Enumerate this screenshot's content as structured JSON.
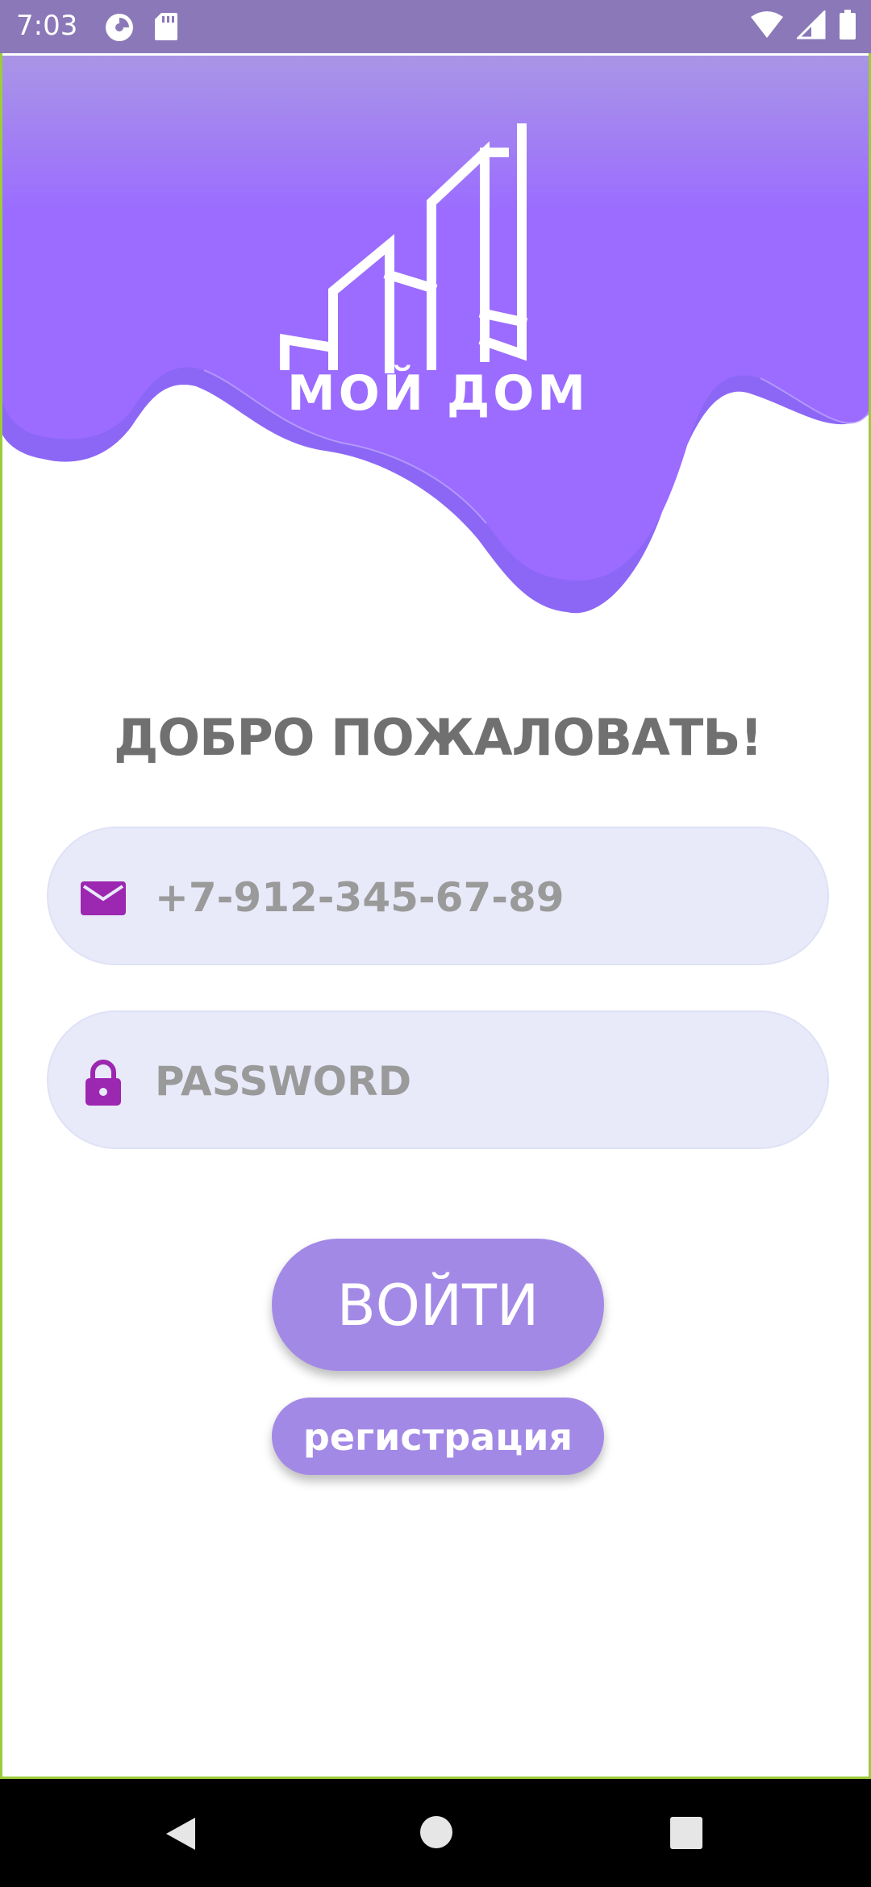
{
  "status_bar": {
    "time": "7:03",
    "left_icons": [
      "data-saver-icon",
      "sd-card-icon"
    ],
    "right_icons": [
      "wifi-icon",
      "cell-signal-icon",
      "battery-icon"
    ]
  },
  "header": {
    "logo_text": "МОЙ ДОМ",
    "gradient_top": "#a98fe8",
    "gradient_main": "#9b6cff"
  },
  "login": {
    "welcome": "ДОБРО ПОЖАЛОВАТЬ!",
    "phone_placeholder": "+7-912-345-67-89",
    "phone_icon": "mail-icon",
    "password_placeholder": "PASSWORD",
    "password_icon": "lock-icon",
    "login_button": "ВОЙТИ",
    "register_button": "регистрация"
  },
  "nav_bar": {
    "buttons": [
      "back-icon",
      "home-icon",
      "recents-icon"
    ]
  },
  "colors": {
    "accent": "#a389e6",
    "field_bg": "#e8eaf9",
    "icon_purple": "#9c27b0",
    "welcome_text": "#707070"
  }
}
